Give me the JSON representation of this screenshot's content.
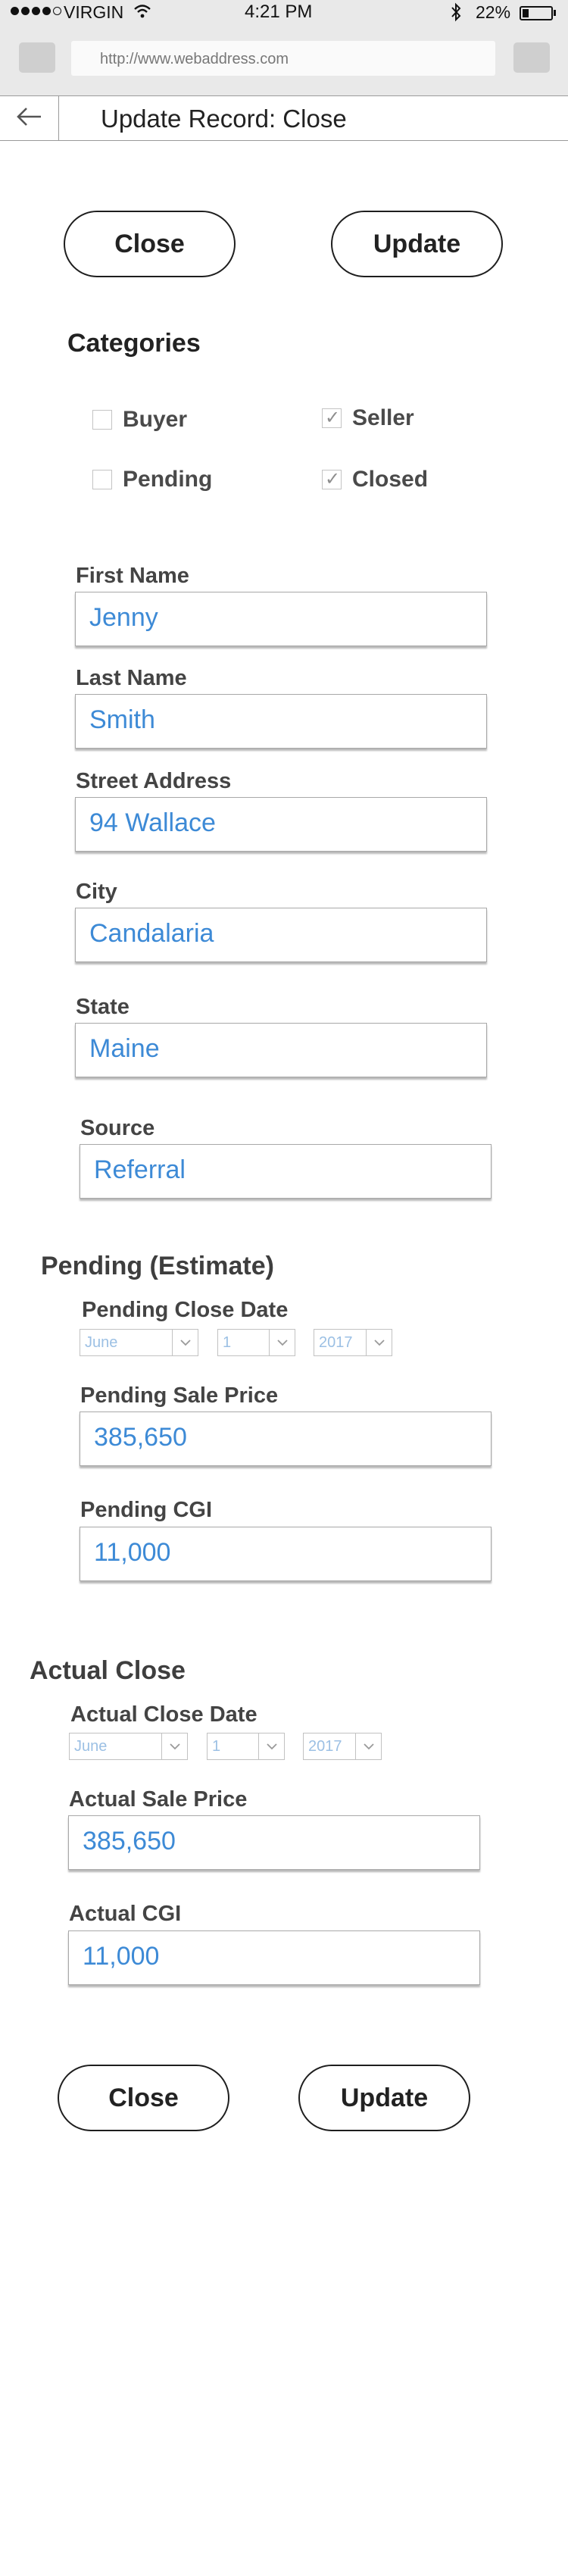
{
  "status_bar": {
    "carrier": "VIRGIN",
    "time": "4:21 PM",
    "battery_text": "22%",
    "battery_level": 0.22
  },
  "browser": {
    "url": "http://www.webaddress.com"
  },
  "header": {
    "title": "Update Record: Close"
  },
  "actions_top": {
    "close_label": "Close",
    "update_label": "Update"
  },
  "categories": {
    "heading": "Categories",
    "items": [
      {
        "label": "Buyer",
        "checked": false
      },
      {
        "label": "Seller",
        "checked": true
      },
      {
        "label": "Pending",
        "checked": false
      },
      {
        "label": "Closed",
        "checked": true
      }
    ]
  },
  "contact": {
    "first_name": {
      "label": "First Name",
      "value": "Jenny"
    },
    "last_name": {
      "label": "Last Name",
      "value": "Smith"
    },
    "street": {
      "label": "Street Address",
      "value": "94 Wallace"
    },
    "city": {
      "label": "City",
      "value": "Candalaria"
    },
    "state": {
      "label": "State",
      "value": "Maine"
    },
    "source": {
      "label": "Source",
      "value": "Referral"
    }
  },
  "pending": {
    "heading": "Pending (Estimate)",
    "close_date": {
      "label": "Pending Close Date",
      "month": "June",
      "day": "1",
      "year": "2017"
    },
    "sale_price": {
      "label": "Pending Sale Price",
      "value": "385,650"
    },
    "cgi": {
      "label": "Pending CGI",
      "value": "11,000"
    }
  },
  "actual": {
    "heading": "Actual Close",
    "close_date": {
      "label": "Actual Close Date",
      "month": "June",
      "day": "1",
      "year": "2017"
    },
    "sale_price": {
      "label": "Actual Sale Price",
      "value": "385,650"
    },
    "cgi": {
      "label": "Actual CGI",
      "value": "11,000"
    }
  },
  "actions_bottom": {
    "close_label": "Close",
    "update_label": "Update"
  },
  "colors": {
    "input_text": "#3d8ad6",
    "select_text": "#9cc0e4",
    "chrome_bg": "#e9e9e9"
  },
  "icons": [
    "signal-dots-icon",
    "wifi-icon",
    "bluetooth-icon",
    "battery-icon",
    "back-arrow-icon",
    "chevron-down-icon",
    "checkmark-icon"
  ]
}
